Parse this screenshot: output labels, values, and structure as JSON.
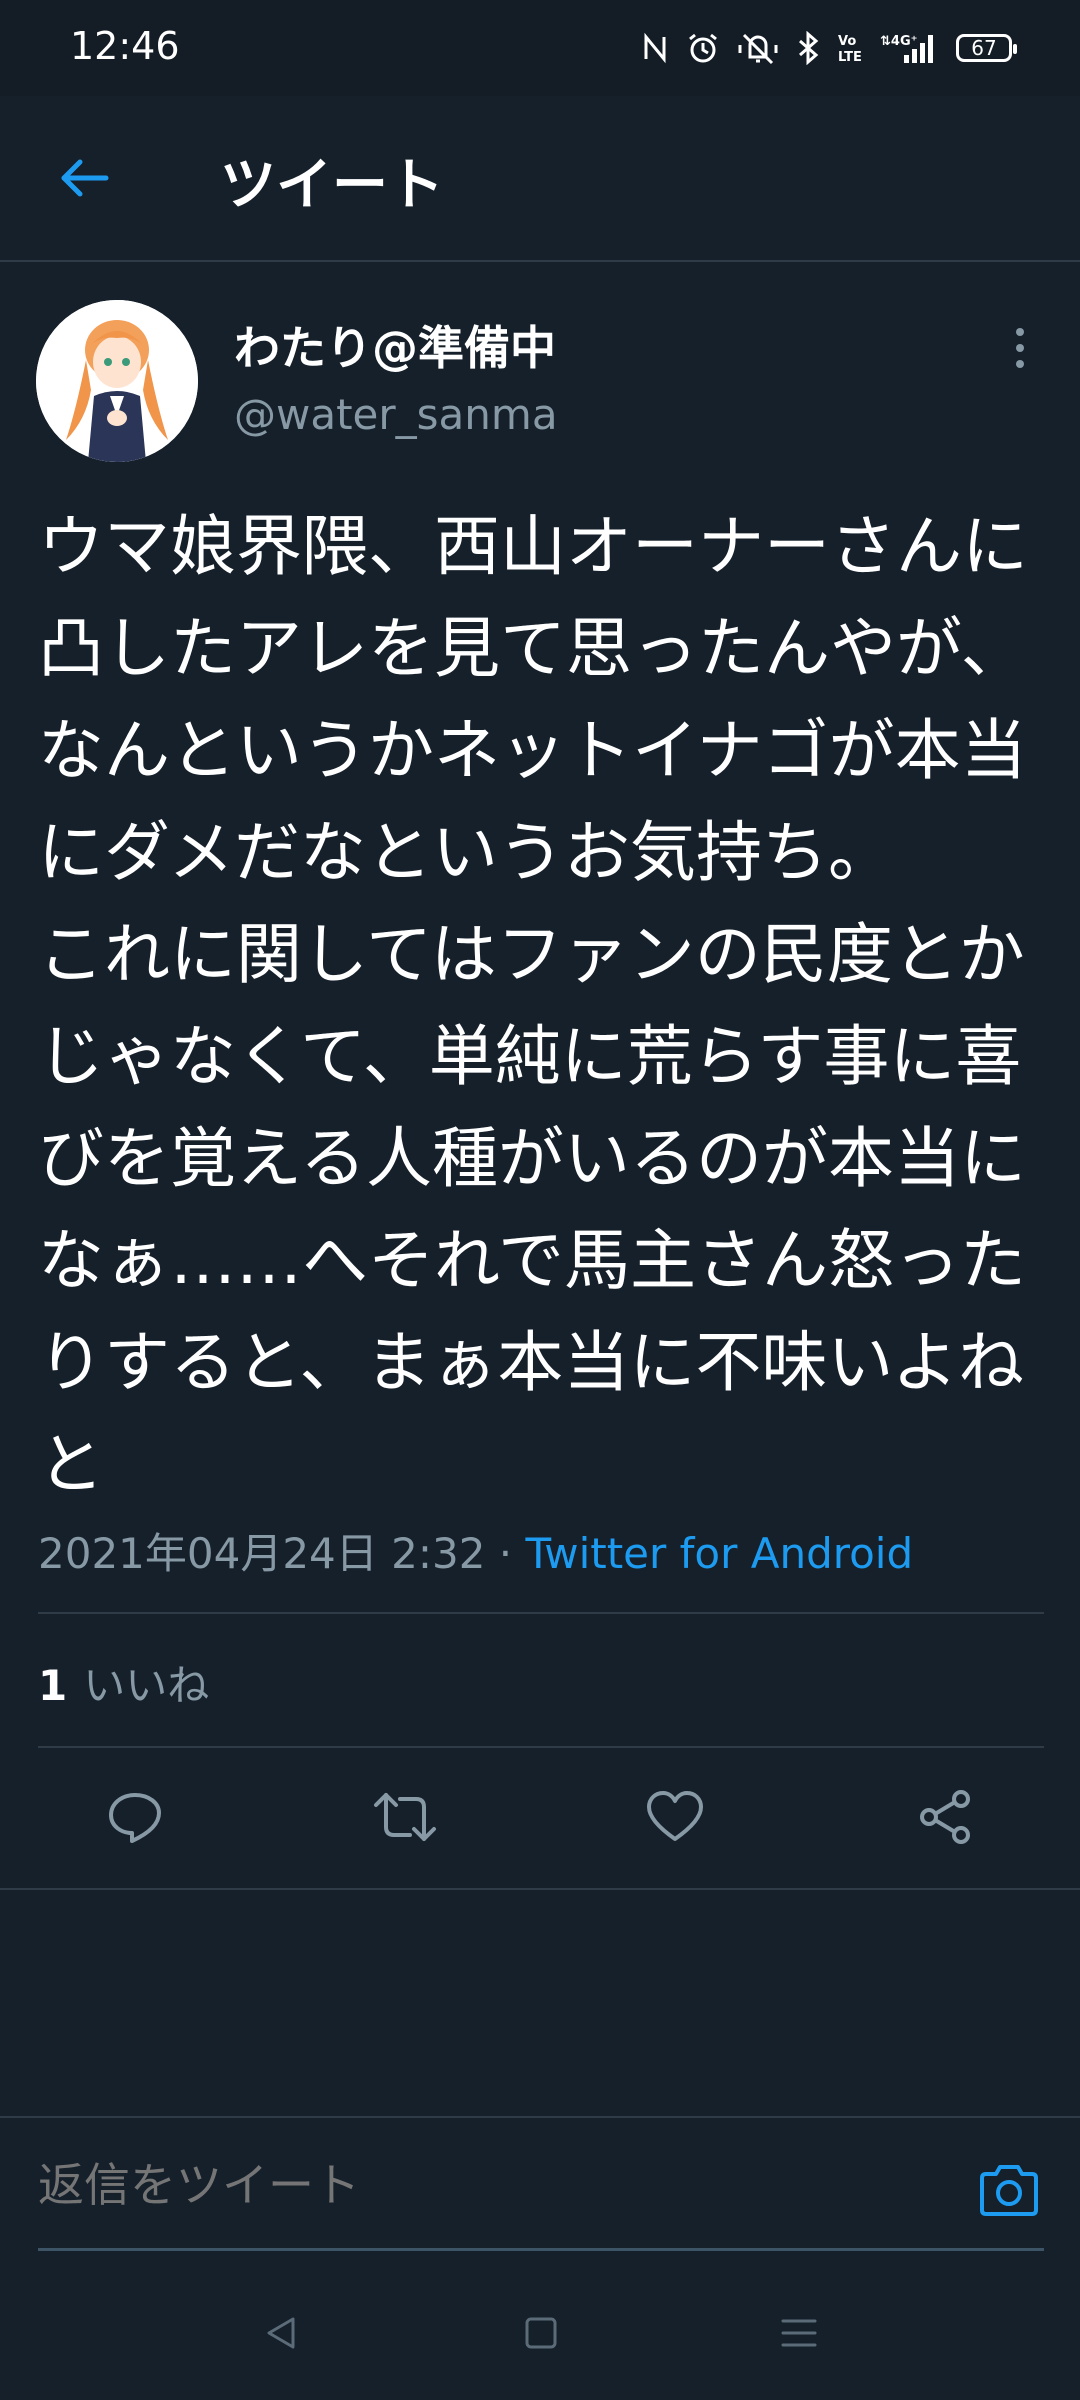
{
  "status_bar": {
    "time": "12:46",
    "battery": "67",
    "icons": [
      "nfc-icon",
      "alarm-icon",
      "mute-icon",
      "bluetooth-icon",
      "volte-icon",
      "signal-4g-icon",
      "battery-icon"
    ]
  },
  "header": {
    "title": "ツイート",
    "back_icon": "arrow-left-icon"
  },
  "tweet": {
    "display_name": "わたり@準備中",
    "handle": "@water_sanma",
    "text": "ウマ娘界隈、西山オーナーさんに凸したアレを見て思ったんやが、なんというかネットイナゴが本当にダメだなというお気持ち。\nこれに関してはファンの民度とかじゃなくて、単純に荒らす事に喜びを覚える人種がいるのが本当になぁ……へそれで馬主さん怒ったりすると、まぁ本当に不味いよねと",
    "date": "2021年04月24日 2:32",
    "separator": " · ",
    "source": "Twitter for Android",
    "likes_count": "1",
    "likes_label": "いいね"
  },
  "actions": {
    "icons": [
      "reply-icon",
      "retweet-icon",
      "like-icon",
      "share-icon"
    ]
  },
  "reply": {
    "placeholder": "返信をツイート",
    "camera_icon": "camera-icon"
  },
  "nav": {
    "icons": [
      "nav-back-icon",
      "nav-home-icon",
      "nav-menu-icon"
    ]
  },
  "colors": {
    "background": "#15202b",
    "accent": "#1d9bf0",
    "secondary_text": "#8899a6",
    "divider": "#2f3b47"
  }
}
